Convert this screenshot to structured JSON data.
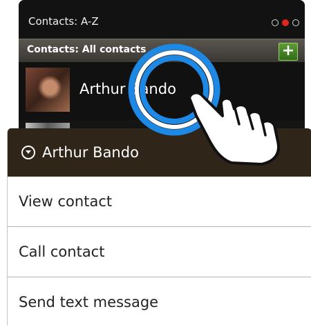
{
  "screen": {
    "title": "Contacts: A-Z",
    "page_dots": 3,
    "active_dot": 1
  },
  "list_header": {
    "label": "Contacts: All contacts",
    "add_label": "+"
  },
  "contact": {
    "name": "Arthur Bando"
  },
  "context_menu": {
    "title": "Arthur Bando",
    "items": [
      {
        "label": "View contact"
      },
      {
        "label": "Call contact"
      },
      {
        "label": "Send text message"
      }
    ]
  },
  "colors": {
    "tap_ring": "#1e88e5",
    "active_dot": "#e0241f",
    "add_button": "#3f8a23",
    "menu_header": "#2f2519"
  },
  "icons": {
    "menu_header_icon": "circle-chevron-down-icon",
    "gesture_icon": "pointing-hand-icon"
  }
}
